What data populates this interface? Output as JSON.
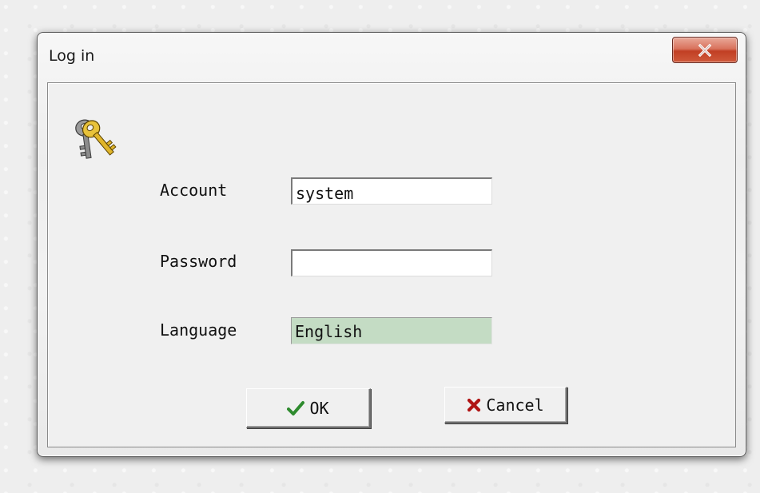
{
  "window": {
    "title": "Log in",
    "close_icon": "close-x-icon"
  },
  "dialog": {
    "icon": "keys-icon",
    "account": {
      "label": "Account",
      "value": "system"
    },
    "password": {
      "label": "Password",
      "value": ""
    },
    "language": {
      "label": "Language",
      "value": "English",
      "highlight_color": "#c4dcc4"
    }
  },
  "buttons": {
    "ok": {
      "label": "OK",
      "icon": "checkmark-icon",
      "icon_color": "#2e8b2e"
    },
    "cancel": {
      "label": "Cancel",
      "icon": "cross-icon",
      "icon_color": "#b01414"
    }
  },
  "colors": {
    "close_button": "#c94a2f",
    "client_background": "#f0f0f0"
  }
}
